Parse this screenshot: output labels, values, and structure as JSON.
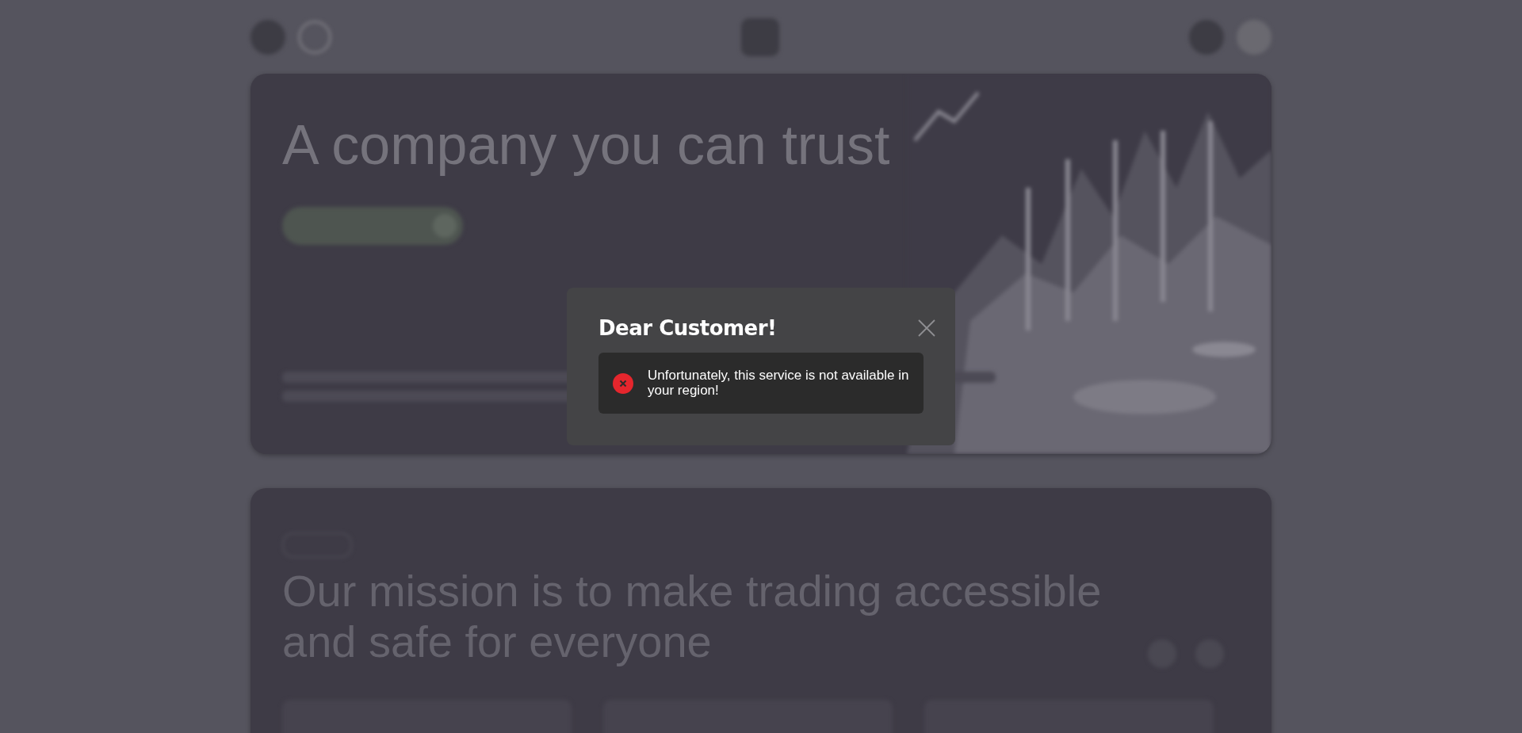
{
  "hero": {
    "title": "A company you can trust"
  },
  "mission": {
    "title": "Our mission is to make trading accessible and safe for everyone"
  },
  "modal": {
    "title": "Dear Customer!",
    "kind": "error",
    "message": "Unfortunately, this service is not available in your region!"
  }
}
